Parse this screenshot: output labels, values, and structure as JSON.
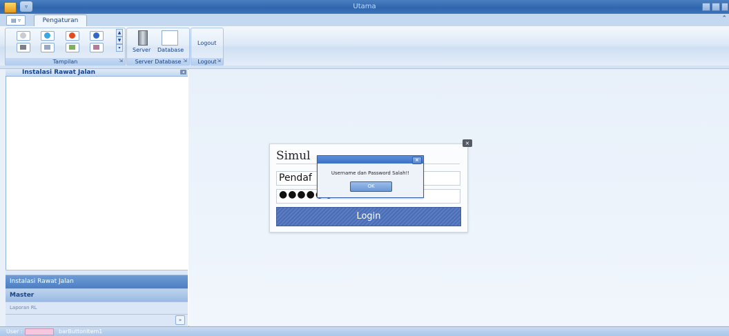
{
  "window": {
    "title": "Utama"
  },
  "qat": {
    "menu_glyph": "▿"
  },
  "tabs": {
    "menu_label": "▤ ▿",
    "active": "Pengaturan",
    "collapse": "⌃"
  },
  "ribbon": {
    "groups": [
      {
        "label": "Tampilan"
      },
      {
        "label": "Server Database"
      },
      {
        "label": "Logout"
      }
    ],
    "buttons": {
      "server": "Server",
      "database": "Database",
      "logout": "Logout"
    }
  },
  "nav": {
    "header": "Instalasi Rawat Jalan",
    "groups": [
      "Instalasi Rawat Jalan",
      "Master",
      "Laporan RL"
    ],
    "footer_glyph": "»"
  },
  "status": {
    "user_label": "User :",
    "item": "barButtonItem1"
  },
  "login": {
    "title": "Simul",
    "username_value": "Pendaf",
    "password_value": "●●●●●●",
    "button": "Login",
    "close_glyph": "×"
  },
  "dialog": {
    "message": "Username dan Password Salah!!",
    "ok": "OK",
    "close_glyph": "×"
  }
}
